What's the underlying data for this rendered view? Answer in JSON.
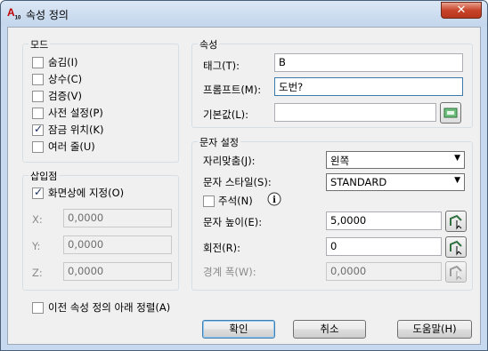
{
  "window": {
    "title": "속성 정의",
    "close_label": "✕"
  },
  "mode": {
    "title": "모드",
    "options": [
      {
        "label": "숨김(I)",
        "checked": false
      },
      {
        "label": "상수(C)",
        "checked": false
      },
      {
        "label": "검증(V)",
        "checked": false
      },
      {
        "label": "사전 설정(P)",
        "checked": false
      },
      {
        "label": "잠금 위치(K)",
        "checked": true
      },
      {
        "label": "여러 줄(U)",
        "checked": false
      }
    ]
  },
  "attribute": {
    "title": "속성",
    "tag_label": "태그(T):",
    "tag_value": "B",
    "prompt_label": "프롬프트(M):",
    "prompt_value": "도번?",
    "default_label": "기본값(L):",
    "default_value": ""
  },
  "insertion": {
    "title": "삽입점",
    "specify_label": "화면상에 지정(O)",
    "specify_checked": true,
    "x_label": "X:",
    "x_value": "0,0000",
    "y_label": "Y:",
    "y_value": "0,0000",
    "z_label": "Z:",
    "z_value": "0,0000"
  },
  "text_settings": {
    "title": "문자 설정",
    "justification_label": "자리맞춤(J):",
    "justification_value": "왼쪽",
    "style_label": "문자 스타일(S):",
    "style_value": "STANDARD",
    "annotative_label": "주석(N)",
    "annotative_checked": false,
    "height_label": "문자 높이(E):",
    "height_value": "5,0000",
    "rotation_label": "회전(R):",
    "rotation_value": "0",
    "boundary_label": "경계 폭(W):",
    "boundary_value": "0,0000"
  },
  "align_below": {
    "label": "이전 속성 정의 아래 정렬(A)",
    "checked": false
  },
  "buttons": {
    "ok": "확인",
    "cancel": "취소",
    "help": "도움말(H)"
  }
}
